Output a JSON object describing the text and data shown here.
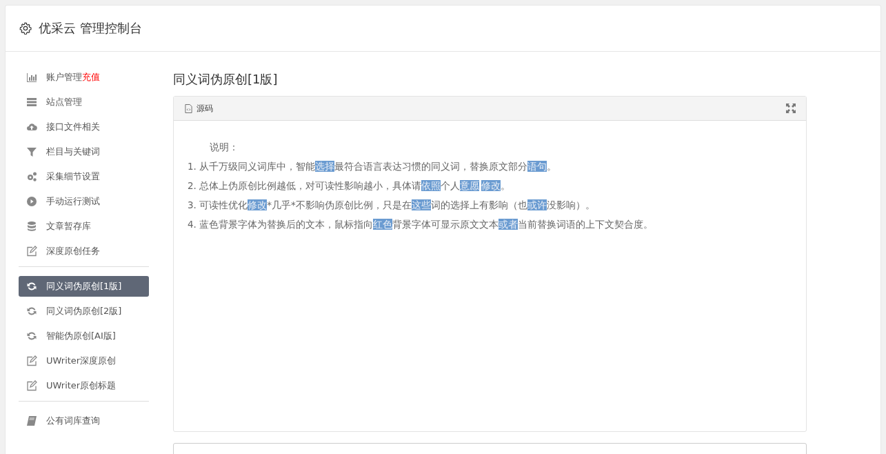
{
  "header": {
    "title": "优采云 管理控制台"
  },
  "sidebar": {
    "groups": [
      [
        {
          "label": "账户管理",
          "badge": "充值",
          "selected": false
        },
        {
          "label": "站点管理",
          "selected": false
        },
        {
          "label": "接口文件相关",
          "selected": false
        },
        {
          "label": "栏目与关键词",
          "selected": false
        },
        {
          "label": "采集细节设置",
          "selected": false
        },
        {
          "label": "手动运行测试",
          "selected": false
        },
        {
          "label": "文章暂存库",
          "selected": false
        },
        {
          "label": "深度原创任务",
          "selected": false
        }
      ],
      [
        {
          "label": "同义词伪原创[1版]",
          "selected": true
        },
        {
          "label": "同义词伪原创[2版]",
          "selected": false
        },
        {
          "label": "智能伪原创[AI版]",
          "selected": false
        },
        {
          "label": "UWriter深度原创",
          "selected": false
        },
        {
          "label": "UWriter原创标题",
          "selected": false
        }
      ],
      [
        {
          "label": "公有词库查询",
          "selected": false
        }
      ]
    ]
  },
  "main": {
    "title": "同义词伪原创[1版]",
    "panel": {
      "tab": "源码",
      "heading": "说明：",
      "lines": [
        [
          {
            "text": "1. 从千万级同义词库中，智能",
            "highlighted": false
          },
          {
            "text": "选择",
            "highlighted": true
          },
          {
            "text": "最符合语言表达习惯的同义词，替换原文部分",
            "highlighted": false
          },
          {
            "text": "语句",
            "highlighted": true
          },
          {
            "text": "。",
            "highlighted": false
          }
        ],
        [
          {
            "text": "2. 总体上伪原创比例越低，对可读性影响越小，具体请",
            "highlighted": false
          },
          {
            "text": "依照",
            "highlighted": true
          },
          {
            "text": "个人",
            "highlighted": false
          },
          {
            "text": "意愿",
            "highlighted": true
          },
          {
            "text": "修改",
            "highlighted": true
          },
          {
            "text": "。",
            "highlighted": false
          }
        ],
        [
          {
            "text": "3. 可读性优化",
            "highlighted": false
          },
          {
            "text": "修改",
            "highlighted": true
          },
          {
            "text": "*几乎*不影响伪原创比例，只是在",
            "highlighted": false
          },
          {
            "text": "这些",
            "highlighted": true
          },
          {
            "text": "词的选择上有影响（也",
            "highlighted": false
          },
          {
            "text": "或许",
            "highlighted": true
          },
          {
            "text": "没影响）。",
            "highlighted": false
          }
        ],
        [
          {
            "text": "4. 蓝色背景字体为替换后的文本，鼠标指向",
            "highlighted": false
          },
          {
            "text": "红色",
            "highlighted": true
          },
          {
            "text": "背景字体可显示原文文本",
            "highlighted": false
          },
          {
            "text": "或者",
            "highlighted": true
          },
          {
            "text": "当前替换词语的上下文契合度。",
            "highlighted": false
          }
        ]
      ]
    }
  }
}
